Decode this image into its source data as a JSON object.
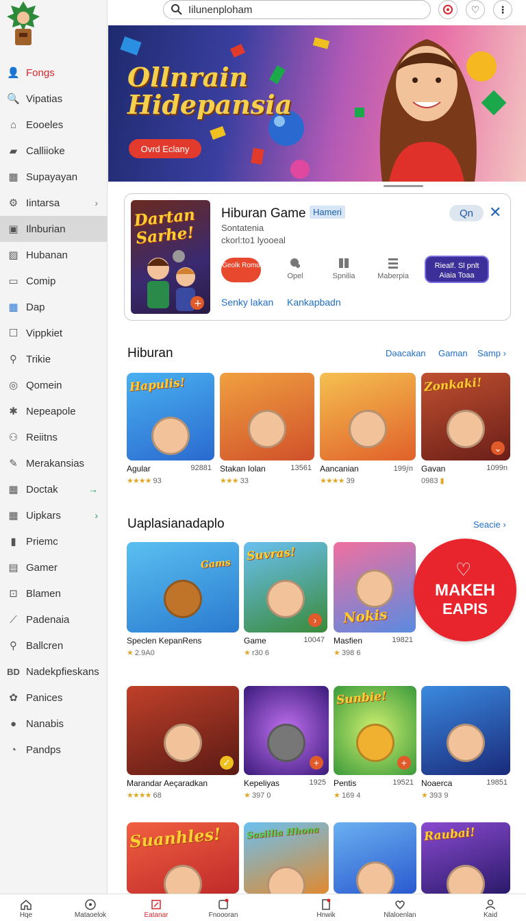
{
  "search": {
    "placeholder": "Iilunenploham"
  },
  "sidebar": {
    "items": [
      {
        "label": "Fongs",
        "icon": "person-icon"
      },
      {
        "label": "Vipatias",
        "icon": "search-icon"
      },
      {
        "label": "Eooeles",
        "icon": "home-icon"
      },
      {
        "label": "Calliioke",
        "icon": "folder-icon"
      },
      {
        "label": "Supayayan",
        "icon": "grid-icon"
      },
      {
        "label": "Iintarsa",
        "icon": "gear-icon"
      },
      {
        "label": "Ilnburian",
        "icon": "image-icon"
      },
      {
        "label": "Hubanan",
        "icon": "picture-icon"
      },
      {
        "label": "Comip",
        "icon": "window-icon"
      },
      {
        "label": "Dap",
        "icon": "apps-icon"
      },
      {
        "label": "Vippkiet",
        "icon": "square-icon"
      },
      {
        "label": "Trikie",
        "icon": "search-user-icon"
      },
      {
        "label": "Qomein",
        "icon": "target-icon"
      },
      {
        "label": "Nepeapole",
        "icon": "sparkle-icon"
      },
      {
        "label": "Reiitns",
        "icon": "users-icon"
      },
      {
        "label": "Merakansias",
        "icon": "pen-icon"
      },
      {
        "label": "Doctak",
        "icon": "grid-icon"
      },
      {
        "label": "Uipkars",
        "icon": "grid-icon"
      },
      {
        "label": "Priemc",
        "icon": "bars-icon"
      },
      {
        "label": "Gamer",
        "icon": "card-icon"
      },
      {
        "label": "Blamen",
        "icon": "download-icon"
      },
      {
        "label": "Padenaia",
        "icon": "tool-icon"
      },
      {
        "label": "Ballcren",
        "icon": "search-icon"
      },
      {
        "label": "Nadekpfieskans",
        "icon": "bd-icon"
      },
      {
        "label": "Panices",
        "icon": "flower-icon"
      },
      {
        "label": "Nanabis",
        "icon": "person-icon"
      },
      {
        "label": "Pandps",
        "icon": "clock-icon"
      }
    ]
  },
  "banner": {
    "title_line1": "Ollnrain",
    "title_line2": "Hidepansia",
    "button": "Ovrd Eclany"
  },
  "featured": {
    "art_text": "Dartan Sarhe!",
    "title": "Hiburan Game",
    "badge": "Hameri",
    "sub1": "Sontatenia",
    "sub2": "ckorl:to1 lyooeal",
    "q_button": "Qn",
    "red_button": "Geolk Romd",
    "actions": [
      "Opel",
      "Spnilia",
      "Maberpia"
    ],
    "purple_button": "Riealf. Sl pnlt Aiaia Toaa",
    "links": [
      "Senky lakan",
      "Kankapbadn"
    ]
  },
  "section1": {
    "title": "Hiburan",
    "links": [
      "Dǝacakan",
      "Gaman",
      "Samp"
    ],
    "tiles": [
      {
        "art": "Hapulis!",
        "name": "Agular",
        "num": "92881",
        "stars": "★★★★",
        "rating": "93",
        "color": "#3d9be0"
      },
      {
        "art": "",
        "name": "Stakan Iolan",
        "num": "13561",
        "stars": "★★★",
        "rating": "33",
        "color": "#e37a2a"
      },
      {
        "art": "",
        "name": "Aancanian",
        "num": "199ⅉn",
        "stars": "★★★★",
        "rating": "39",
        "color": "#f0a040"
      },
      {
        "art": "Zonkaki!",
        "name": "Gavan",
        "num": "1099n",
        "stars": "",
        "rating": "0983",
        "color": "#a8392c"
      }
    ]
  },
  "section2": {
    "title": "Uaplasianadaplo",
    "link": "Seacie",
    "tiles": [
      {
        "art": "Gams",
        "name": "Speclen KepanRens",
        "num": "",
        "stars": "★",
        "rating": "2.9A0",
        "color": "#2a8fe0"
      },
      {
        "art": "Suvras!",
        "name": "Game",
        "num": "10047",
        "stars": "★",
        "rating": "r30 6",
        "color": "#3a7acc"
      },
      {
        "art": "Nokis",
        "name": "Masfien",
        "num": "19821",
        "stars": "★",
        "rating": "398 6",
        "color": "#e2568a"
      }
    ]
  },
  "promo": {
    "line1": "MAKEH",
    "line2": "EAPIS"
  },
  "section3": {
    "tiles": [
      {
        "art": "",
        "name": "Marandar Aeçaradkan",
        "num": "",
        "stars": "★★★★",
        "rating": "68",
        "color": "#b33a2a"
      },
      {
        "art": "",
        "name": "Kepeliyas",
        "num": "1925",
        "stars": "★",
        "rating": "397 0",
        "color": "#5a2a9a"
      },
      {
        "art": "Sunbie!",
        "name": "Pentis",
        "num": "19521",
        "stars": "★",
        "rating": "169 4",
        "color": "#7ac23a"
      },
      {
        "art": "",
        "name": "Noaerca",
        "num": "19851",
        "stars": "★",
        "rating": "393 9",
        "color": "#2a5ad0"
      }
    ]
  },
  "section4": {
    "tiles": [
      {
        "art": "Suanhles!",
        "color": "#e0402a"
      },
      {
        "art": "Sasiilia Hhona",
        "color": "#3aa0e0"
      },
      {
        "art": "",
        "color": "#3a8ae0"
      },
      {
        "art": "Raubai!",
        "color": "#6a3ab0"
      }
    ]
  },
  "bottom_nav": [
    {
      "label": "Hqe",
      "icon": "home-icon"
    },
    {
      "label": "Mataoelok",
      "icon": "compass-icon"
    },
    {
      "label": "Eatanar",
      "icon": "edit-icon"
    },
    {
      "label": "Fnoooran",
      "icon": "dice-icon"
    },
    {
      "label": "Hnwik",
      "icon": "document-icon"
    },
    {
      "label": "Nlaloenlan",
      "icon": "heart-icon"
    },
    {
      "label": "Kaid",
      "icon": "user-icon"
    }
  ]
}
